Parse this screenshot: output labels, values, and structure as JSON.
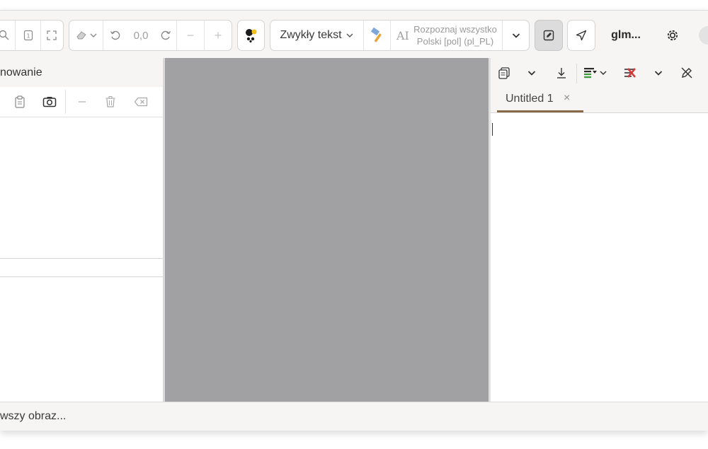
{
  "toolbar": {
    "rotation_value": "0,0",
    "text_mode_label": "Zwykły tekst",
    "recognize_line1": "Rozpoznaj wszystko",
    "recognize_line2": "Polski [pol] (pl_PL)",
    "ai_glyph": "AI",
    "user_label": "glm...",
    "minus": "−",
    "plus": "+"
  },
  "left_panel": {
    "title": "nowanie"
  },
  "right_panel": {
    "tab_label": "Untitled 1",
    "tab_close": "×"
  },
  "status": {
    "text": "wszy obraz..."
  },
  "colors": {
    "canvas": "#a1a1a4",
    "tab_underline": "#8a6a46",
    "accent_red": "#d43c3c",
    "accent_green": "#3a9a3a"
  }
}
